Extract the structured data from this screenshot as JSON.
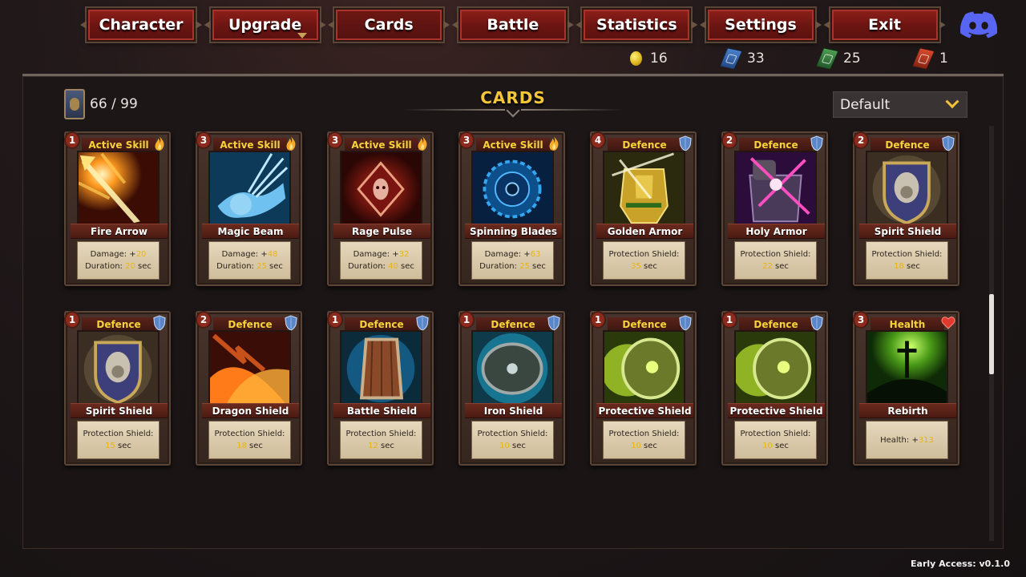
{
  "nav": {
    "items": [
      {
        "label": "Character",
        "name": "nav-character-button",
        "active": false
      },
      {
        "label": "Upgrade",
        "name": "nav-upgrade-button",
        "active": false
      },
      {
        "label": "Cards",
        "name": "nav-cards-button",
        "active": true
      },
      {
        "label": "Battle",
        "name": "nav-battle-button",
        "active": false
      },
      {
        "label": "Statistics",
        "name": "nav-statistics-button",
        "active": false
      },
      {
        "label": "Settings",
        "name": "nav-settings-button",
        "active": false
      },
      {
        "label": "Exit",
        "name": "nav-exit-button",
        "active": false
      }
    ],
    "discord_icon": "discord-icon"
  },
  "currency": {
    "gold": {
      "value": "16",
      "icon": "gold-coin-icon",
      "color": "#e0b820"
    },
    "blue_book": {
      "value": "33",
      "icon": "blue-book-icon",
      "color": "#3d6fb8"
    },
    "green_book": {
      "value": "25",
      "icon": "green-book-icon",
      "color": "#3f8b45"
    },
    "red_book": {
      "value": "1",
      "icon": "red-book-icon",
      "color": "#c9402a"
    }
  },
  "deck": {
    "count": "66 / 99",
    "icon": "card-deck-icon"
  },
  "title": "CARDS",
  "sort": {
    "selected": "Default"
  },
  "cards": [
    {
      "level": "1",
      "type": "Active Skill",
      "type_icon": "fire-icon",
      "name": "Fire Arrow",
      "art": "fire-arrow",
      "lines": [
        {
          "label": "Damage: +",
          "value": "20",
          "suffix": ""
        },
        {
          "label": "Duration: ",
          "value": "20",
          "suffix": " sec"
        }
      ]
    },
    {
      "level": "3",
      "type": "Active Skill",
      "type_icon": "fire-icon",
      "name": "Magic Beam",
      "art": "magic-beam",
      "lines": [
        {
          "label": "Damage: +",
          "value": "48",
          "suffix": ""
        },
        {
          "label": "Duration: ",
          "value": "25",
          "suffix": " sec"
        }
      ]
    },
    {
      "level": "3",
      "type": "Active Skill",
      "type_icon": "fire-icon",
      "name": "Rage Pulse",
      "art": "rage-pulse",
      "lines": [
        {
          "label": "Damage: +",
          "value": "32",
          "suffix": ""
        },
        {
          "label": "Duration: ",
          "value": "40",
          "suffix": " sec"
        }
      ]
    },
    {
      "level": "3",
      "type": "Active Skill",
      "type_icon": "fire-icon",
      "name": "Spinning Blades",
      "art": "spinning-blades",
      "lines": [
        {
          "label": "Damage: +",
          "value": "63",
          "suffix": ""
        },
        {
          "label": "Duration: ",
          "value": "25",
          "suffix": " sec"
        }
      ]
    },
    {
      "level": "4",
      "type": "Defence",
      "type_icon": "shield-icon",
      "name": "Golden Armor",
      "art": "golden-armor",
      "lines": [
        {
          "label": "Protection Shield:",
          "value": "",
          "suffix": ""
        },
        {
          "label": "",
          "value": "35",
          "suffix": " sec"
        }
      ]
    },
    {
      "level": "2",
      "type": "Defence",
      "type_icon": "shield-icon",
      "name": "Holy Armor",
      "art": "holy-armor",
      "lines": [
        {
          "label": "Protection Shield:",
          "value": "",
          "suffix": ""
        },
        {
          "label": "",
          "value": "22",
          "suffix": " sec"
        }
      ]
    },
    {
      "level": "2",
      "type": "Defence",
      "type_icon": "shield-icon",
      "name": "Spirit Shield",
      "art": "spirit-shield",
      "lines": [
        {
          "label": "Protection Shield:",
          "value": "",
          "suffix": ""
        },
        {
          "label": "",
          "value": "18",
          "suffix": " sec"
        }
      ]
    },
    {
      "level": "1",
      "type": "Defence",
      "type_icon": "shield-icon",
      "name": "Spirit Shield",
      "art": "spirit-shield",
      "lines": [
        {
          "label": "Protection Shield:",
          "value": "",
          "suffix": ""
        },
        {
          "label": "",
          "value": "15",
          "suffix": " sec"
        }
      ]
    },
    {
      "level": "2",
      "type": "Defence",
      "type_icon": "shield-icon",
      "name": "Dragon Shield",
      "art": "dragon-shield",
      "lines": [
        {
          "label": "Protection Shield:",
          "value": "",
          "suffix": ""
        },
        {
          "label": "",
          "value": "18",
          "suffix": " sec"
        }
      ]
    },
    {
      "level": "1",
      "type": "Defence",
      "type_icon": "shield-icon",
      "name": "Battle Shield",
      "art": "battle-shield",
      "lines": [
        {
          "label": "Protection Shield:",
          "value": "",
          "suffix": ""
        },
        {
          "label": "",
          "value": "12",
          "suffix": " sec"
        }
      ]
    },
    {
      "level": "1",
      "type": "Defence",
      "type_icon": "shield-icon",
      "name": "Iron Shield",
      "art": "iron-shield",
      "lines": [
        {
          "label": "Protection Shield:",
          "value": "",
          "suffix": ""
        },
        {
          "label": "",
          "value": "10",
          "suffix": " sec"
        }
      ]
    },
    {
      "level": "1",
      "type": "Defence",
      "type_icon": "shield-icon",
      "name": "Protective Shield",
      "art": "protective-shield",
      "lines": [
        {
          "label": "Protection Shield:",
          "value": "",
          "suffix": ""
        },
        {
          "label": "",
          "value": "10",
          "suffix": " sec"
        }
      ]
    },
    {
      "level": "1",
      "type": "Defence",
      "type_icon": "shield-icon",
      "name": "Protective Shield",
      "art": "protective-shield",
      "lines": [
        {
          "label": "Protection Shield:",
          "value": "",
          "suffix": ""
        },
        {
          "label": "",
          "value": "10",
          "suffix": " sec"
        }
      ]
    },
    {
      "level": "3",
      "type": "Health",
      "type_icon": "heart-icon",
      "name": "Rebirth",
      "art": "rebirth",
      "lines": [
        {
          "label": "Health: +",
          "value": "313",
          "suffix": ""
        }
      ]
    }
  ],
  "version": "Early Access: v0.1.0"
}
